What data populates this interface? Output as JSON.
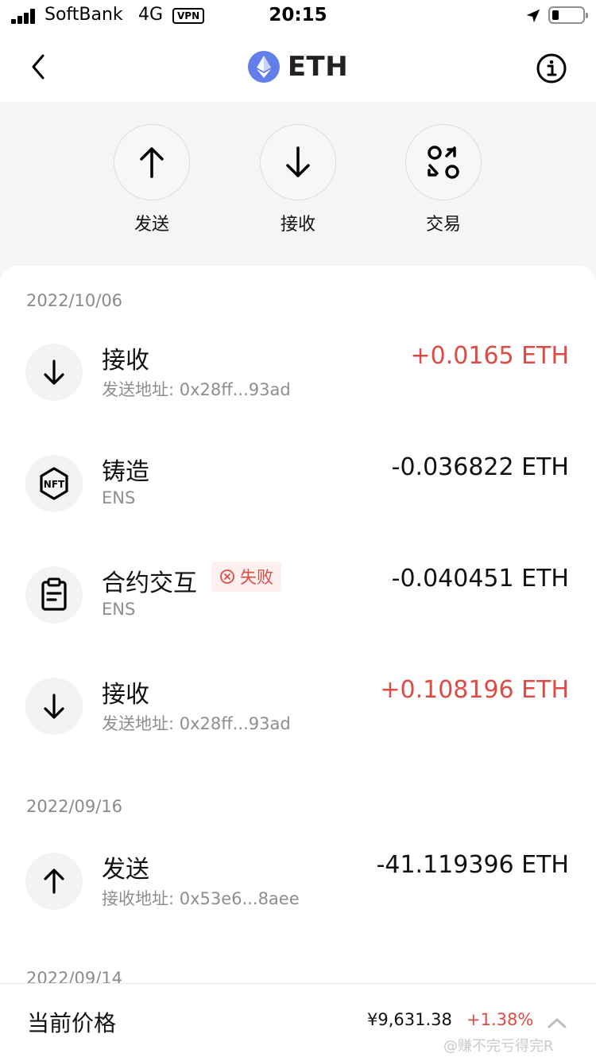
{
  "status_bar": {
    "carrier": "SoftBank",
    "network": "4G",
    "vpn": "VPN",
    "time": "20:15"
  },
  "header": {
    "title": "ETH",
    "logo_icon": "ethereum-logo-icon",
    "back_icon": "chevron-left-icon",
    "info_icon": "info-circle-icon"
  },
  "actions": [
    {
      "label": "发送",
      "icon": "arrow-up-icon"
    },
    {
      "label": "接收",
      "icon": "arrow-down-icon"
    },
    {
      "label": "交易",
      "icon": "swap-icon"
    }
  ],
  "transactions": {
    "group_1": {
      "date": "2022/10/06",
      "items": [
        {
          "title": "接收",
          "subtitle": "发送地址: 0x28ff...93ad",
          "amount": "+0.0165 ETH",
          "icon": "arrow-down-icon",
          "direction": "in"
        },
        {
          "title": "铸造",
          "subtitle": "ENS",
          "amount": "-0.036822 ETH",
          "icon": "nft-icon",
          "direction": "out"
        },
        {
          "title": "合约交互",
          "subtitle": "ENS",
          "amount": "-0.040451 ETH",
          "icon": "clipboard-icon",
          "direction": "out",
          "status": "失败"
        },
        {
          "title": "接收",
          "subtitle": "发送地址: 0x28ff...93ad",
          "amount": "+0.108196 ETH",
          "icon": "arrow-down-icon",
          "direction": "in"
        }
      ]
    },
    "group_2": {
      "date": "2022/09/16",
      "items": [
        {
          "title": "发送",
          "subtitle": "接收地址: 0x53e6...8aee",
          "amount": "-41.119396 ETH",
          "icon": "arrow-up-icon",
          "direction": "out"
        }
      ]
    },
    "group_3": {
      "date": "2022/09/14"
    }
  },
  "price_bar": {
    "label": "当前价格",
    "price": "¥9,631.38",
    "change": "+1.38%",
    "expand_icon": "chevron-up-icon"
  },
  "watermark": "@赚不完亏得完R",
  "colors": {
    "positive": "#dd4b44",
    "eth_brand": "#627eea"
  }
}
